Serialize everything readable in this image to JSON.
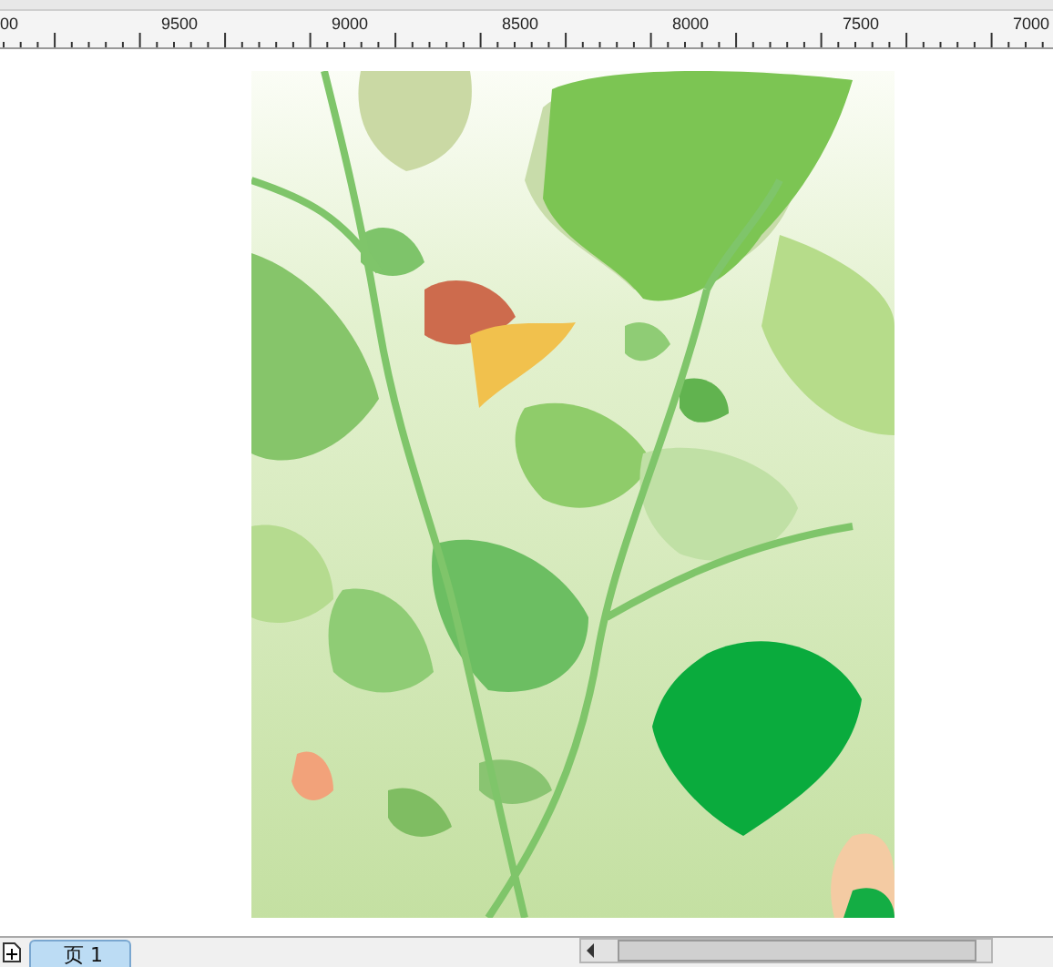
{
  "ruler": {
    "labels": [
      "00",
      "9500",
      "9000",
      "8500",
      "8000",
      "7500",
      "7000"
    ]
  },
  "page_tabs": [
    {
      "label": "页 1",
      "selected": true
    }
  ]
}
